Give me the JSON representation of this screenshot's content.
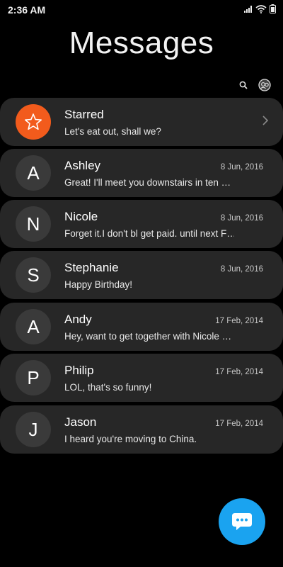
{
  "status_bar": {
    "time": "2:36 AM"
  },
  "header": {
    "title": "Messages"
  },
  "toolbar": {
    "search_icon": "search-icon",
    "profile_icon": "profile-icon"
  },
  "conversations": [
    {
      "name": "Starred",
      "preview": "Let's eat out, shall we?",
      "date": "",
      "avatar": "",
      "type": "starred"
    },
    {
      "name": "Ashley",
      "preview": "Great! I'll meet you downstairs in ten …",
      "date": "8 Jun, 2016",
      "avatar": "A"
    },
    {
      "name": "Nicole",
      "preview": "Forget it.I don't bl get paid. until next F…",
      "date": "8 Jun, 2016",
      "avatar": "N"
    },
    {
      "name": "Stephanie",
      "preview": "Happy Birthday!",
      "date": "8 Jun, 2016",
      "avatar": "S",
      "unread": true
    },
    {
      "name": "Andy",
      "preview": "Hey, want to get together with Nicole …",
      "date": "17 Feb, 2014",
      "avatar": "A"
    },
    {
      "name": "Philip",
      "preview": "LOL, that's so funny!",
      "date": "17 Feb, 2014",
      "avatar": "P"
    },
    {
      "name": "Jason",
      "preview": "I heard you're moving to China.",
      "date": "17 Feb, 2014",
      "avatar": "J"
    }
  ],
  "colors": {
    "accent": "#1aa3f0",
    "starred": "#f25b1c",
    "card": "#272727",
    "unread": "#3aa4f0"
  }
}
